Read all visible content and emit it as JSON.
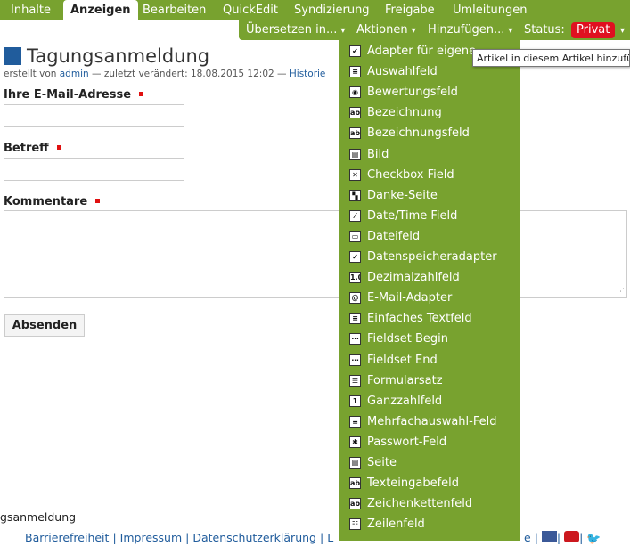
{
  "tabs": [
    {
      "label": "Inhalte"
    },
    {
      "label": "Anzeigen"
    },
    {
      "label": "Bearbeiten"
    },
    {
      "label": "QuickEdit"
    },
    {
      "label": "Syndizierung"
    },
    {
      "label": "Freigabe"
    },
    {
      "label": "Umleitungen"
    }
  ],
  "actions": {
    "translate": "Übersetzen in...",
    "actions": "Aktionen",
    "add": "Hinzufügen...",
    "status_label": "Status:",
    "status_value": "Privat",
    "caret": "▾"
  },
  "page": {
    "title": "Tagungsanmeldung",
    "byline_prefix": "erstellt von",
    "byline_author": "admin",
    "byline_rest": "— zuletzt verändert: 18.08.2015 12:02 —",
    "byline_history": "Historie"
  },
  "form": {
    "email_label": "Ihre E-Mail-Adresse",
    "subject_label": "Betreff",
    "comments_label": "Kommentare",
    "submit_label": "Absenden"
  },
  "footer": {
    "title_fragment": "gsanmeldung",
    "links": [
      "Barrierefreiheit",
      "Impressum",
      "Datenschutzerklärung",
      "L"
    ],
    "social_fragment": "e"
  },
  "tooltip": "Artikel in diesem Artikel hinzufügen",
  "menu": [
    {
      "label": "Adapter für eigene",
      "icon": "adapter-icon",
      "glyph": "✔"
    },
    {
      "label": "Auswahlfeld",
      "icon": "selection-field-icon",
      "glyph": "≡"
    },
    {
      "label": "Bewertungsfeld",
      "icon": "rating-field-icon",
      "glyph": "◉"
    },
    {
      "label": "Bezeichnung",
      "icon": "label-icon",
      "glyph": "ab"
    },
    {
      "label": "Bezeichnungsfeld",
      "icon": "label-field-icon",
      "glyph": "ab"
    },
    {
      "label": "Bild",
      "icon": "image-icon",
      "glyph": "▤"
    },
    {
      "label": "Checkbox Field",
      "icon": "checkbox-icon",
      "glyph": "✕"
    },
    {
      "label": "Danke-Seite",
      "icon": "thanks-page-icon",
      "glyph": "▚"
    },
    {
      "label": "Date/Time Field",
      "icon": "datetime-icon",
      "glyph": "⁄"
    },
    {
      "label": "Dateifeld",
      "icon": "file-field-icon",
      "glyph": "▭"
    },
    {
      "label": "Datenspeicheradapter",
      "icon": "data-adapter-icon",
      "glyph": "✔"
    },
    {
      "label": "Dezimalzahlfeld",
      "icon": "decimal-icon",
      "glyph": "1.0"
    },
    {
      "label": "E-Mail-Adapter",
      "icon": "email-adapter-icon",
      "glyph": "@"
    },
    {
      "label": "Einfaches Textfeld",
      "icon": "plain-text-icon",
      "glyph": "≡"
    },
    {
      "label": "Fieldset Begin",
      "icon": "fieldset-begin-icon",
      "glyph": "⋯"
    },
    {
      "label": "Fieldset End",
      "icon": "fieldset-end-icon",
      "glyph": "⋯"
    },
    {
      "label": "Formularsatz",
      "icon": "form-set-icon",
      "glyph": "☰"
    },
    {
      "label": "Ganzzahlfeld",
      "icon": "integer-icon",
      "glyph": "1"
    },
    {
      "label": "Mehrfachauswahl-Feld",
      "icon": "multi-select-icon",
      "glyph": "≡"
    },
    {
      "label": "Passwort-Feld",
      "icon": "password-icon",
      "glyph": "✱"
    },
    {
      "label": "Seite",
      "icon": "page-icon",
      "glyph": "▤"
    },
    {
      "label": "Texteingabefeld",
      "icon": "text-input-icon",
      "glyph": "ab"
    },
    {
      "label": "Zeichenkettenfeld",
      "icon": "string-field-icon",
      "glyph": "ab"
    },
    {
      "label": "Zeilenfeld",
      "icon": "lines-field-icon",
      "glyph": "☷"
    }
  ]
}
